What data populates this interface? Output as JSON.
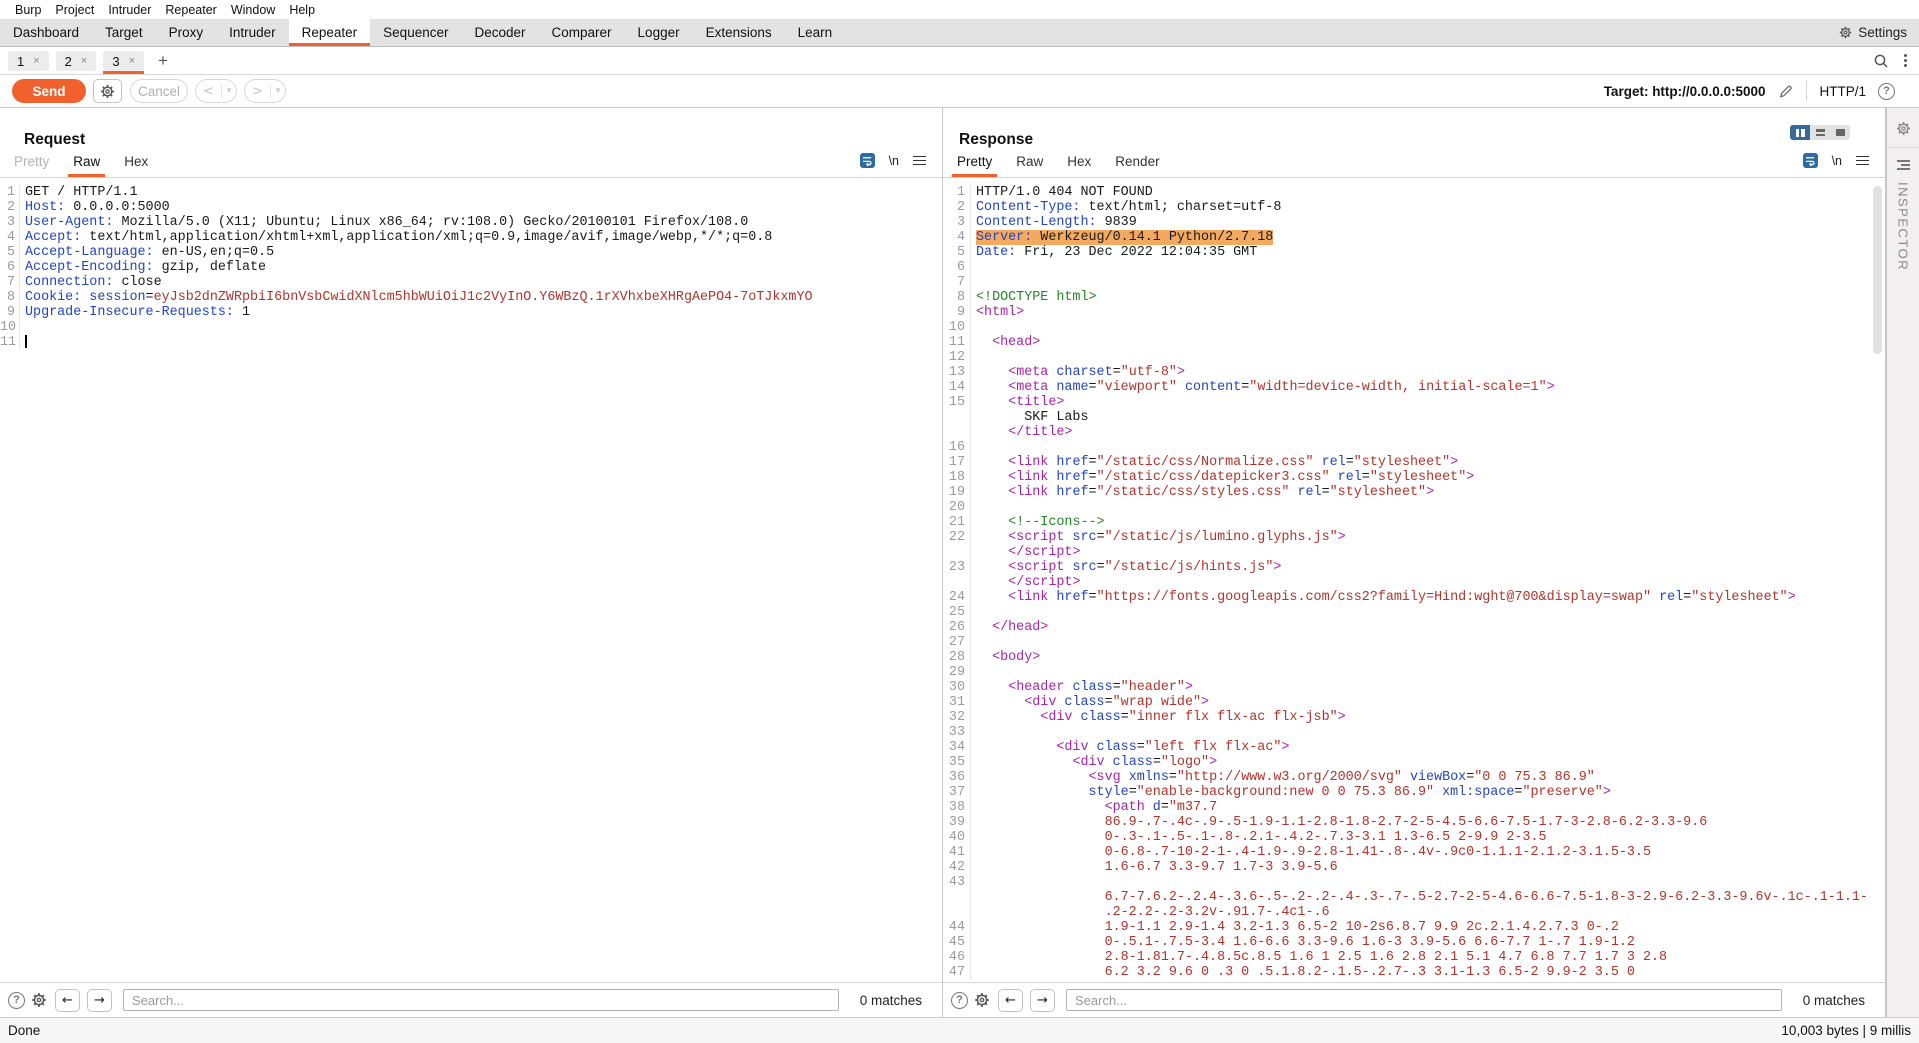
{
  "menu_bar": {
    "items": [
      "Burp",
      "Project",
      "Intruder",
      "Repeater",
      "Window",
      "Help"
    ]
  },
  "main_tab_bar": {
    "tabs": [
      "Dashboard",
      "Target",
      "Proxy",
      "Intruder",
      "Repeater",
      "Sequencer",
      "Decoder",
      "Comparer",
      "Logger",
      "Extensions",
      "Learn"
    ],
    "selected": "Repeater",
    "settings_label": "Settings"
  },
  "session_tabs": {
    "tabs": [
      "1",
      "2",
      "3"
    ],
    "selected": "3",
    "close_glyph": "×",
    "add_glyph": "+"
  },
  "toolbar": {
    "send": "Send",
    "cancel": "Cancel",
    "back": "<",
    "forward": ">",
    "dropdown_glyph": "▾",
    "target": "Target: http://0.0.0.0:5000",
    "protocol": "HTTP/1",
    "help_glyph": "?"
  },
  "request": {
    "title": "Request",
    "tabs": [
      {
        "label": "Pretty",
        "state": "disabled"
      },
      {
        "label": "Raw",
        "state": "selected"
      },
      {
        "label": "Hex",
        "state": "normal"
      }
    ],
    "newline_icon": "\\n",
    "search_placeholder": "Search...",
    "matches": "0 matches",
    "lines": [
      {
        "n": "1",
        "segs": [
          [
            "GET / HTTP/1.1",
            "p"
          ]
        ]
      },
      {
        "n": "2",
        "segs": [
          [
            "Host:",
            "h"
          ],
          [
            " 0.0.0.0:5000",
            "p"
          ]
        ]
      },
      {
        "n": "3",
        "segs": [
          [
            "User-Agent:",
            "h"
          ],
          [
            " Mozilla/5.0 (X11; Ubuntu; Linux x86_64; rv:108.0) Gecko/20100101 Firefox/108.0",
            "p"
          ]
        ]
      },
      {
        "n": "4",
        "segs": [
          [
            "Accept:",
            "h"
          ],
          [
            " text/html,application/xhtml+xml,application/xml;q=0.9,image/avif,image/webp,*/*;q=0.8",
            "p"
          ]
        ]
      },
      {
        "n": "5",
        "segs": [
          [
            "Accept-Language:",
            "h"
          ],
          [
            " en-US,en;q=0.5",
            "p"
          ]
        ]
      },
      {
        "n": "6",
        "segs": [
          [
            "Accept-Encoding:",
            "h"
          ],
          [
            " gzip, deflate",
            "p"
          ]
        ]
      },
      {
        "n": "7",
        "segs": [
          [
            "Connection:",
            "h"
          ],
          [
            " close",
            "p"
          ]
        ]
      },
      {
        "n": "8",
        "segs": [
          [
            "Cookie:",
            "h"
          ],
          [
            " ",
            "p"
          ],
          [
            "session",
            "h"
          ],
          [
            "=",
            "p"
          ],
          [
            "eyJsb2dnZWRpbiI6bnVsbCwidXNlcm5hbWUiOiJ1c2VyInO.Y6WBzQ.1rXVhxbeXHRgAePO4-7oTJkxmYO",
            "v"
          ]
        ]
      },
      {
        "n": "9",
        "segs": [
          [
            "Upgrade-Insecure-Requests:",
            "h"
          ],
          [
            " 1",
            "p"
          ]
        ]
      },
      {
        "n": "10",
        "segs": []
      },
      {
        "n": "11",
        "segs": [],
        "cursor": true
      }
    ]
  },
  "response": {
    "title": "Response",
    "tabs": [
      {
        "label": "Pretty",
        "state": "selected"
      },
      {
        "label": "Raw",
        "state": "normal"
      },
      {
        "label": "Hex",
        "state": "normal"
      },
      {
        "label": "Render",
        "state": "normal"
      }
    ],
    "newline_icon": "\\n",
    "search_placeholder": "Search...",
    "matches": "0 matches",
    "lines": [
      {
        "n": "1",
        "segs": [
          [
            "HTTP/1.0 404 NOT FOUND",
            "p"
          ]
        ]
      },
      {
        "n": "2",
        "segs": [
          [
            "Content-Type:",
            "h"
          ],
          [
            " text/html; charset=utf-8",
            "p"
          ]
        ]
      },
      {
        "n": "3",
        "segs": [
          [
            "Content-Length:",
            "h"
          ],
          [
            " 9839",
            "p"
          ]
        ]
      },
      {
        "n": "4",
        "hl": true,
        "segs": [
          [
            "Server:",
            "h"
          ],
          [
            " Werkzeug/0.14.1 Python/2.7.18",
            "p"
          ]
        ]
      },
      {
        "n": "5",
        "segs": [
          [
            "Date:",
            "h"
          ],
          [
            " Fri, 23 Dec 2022 12:04:35 GMT",
            "p"
          ]
        ]
      },
      {
        "n": "6",
        "segs": []
      },
      {
        "n": "7",
        "segs": []
      },
      {
        "n": "8",
        "segs": [
          [
            "<!DOCTYPE html>",
            "g"
          ]
        ]
      },
      {
        "n": "9",
        "segs": [
          [
            "<html>",
            "t"
          ]
        ]
      },
      {
        "n": "10",
        "segs": []
      },
      {
        "n": "11",
        "segs": [
          [
            "  ",
            "p"
          ],
          [
            "<head>",
            "t"
          ]
        ]
      },
      {
        "n": "12",
        "segs": []
      },
      {
        "n": "13",
        "segs": [
          [
            "    ",
            "p"
          ],
          [
            "<meta",
            "t"
          ],
          [
            " charset",
            "n"
          ],
          [
            "=",
            "p"
          ],
          [
            "\"utf-8\"",
            "v"
          ],
          [
            ">",
            "t"
          ]
        ]
      },
      {
        "n": "14",
        "segs": [
          [
            "    ",
            "p"
          ],
          [
            "<meta",
            "t"
          ],
          [
            " name",
            "n"
          ],
          [
            "=",
            "p"
          ],
          [
            "\"viewport\"",
            "v"
          ],
          [
            " content",
            "n"
          ],
          [
            "=",
            "p"
          ],
          [
            "\"width=device-width, initial-scale=1\"",
            "v"
          ],
          [
            ">",
            "t"
          ]
        ]
      },
      {
        "n": "15",
        "segs": [
          [
            "    ",
            "p"
          ],
          [
            "<title>",
            "t"
          ]
        ]
      },
      {
        "segs": [
          [
            "      SKF Labs",
            "p"
          ]
        ]
      },
      {
        "segs": [
          [
            "    ",
            "p"
          ],
          [
            "</title>",
            "t"
          ]
        ]
      },
      {
        "n": "16",
        "segs": []
      },
      {
        "n": "17",
        "segs": [
          [
            "    ",
            "p"
          ],
          [
            "<link",
            "t"
          ],
          [
            " href",
            "n"
          ],
          [
            "=",
            "p"
          ],
          [
            "\"/static/css/Normalize.css\"",
            "v"
          ],
          [
            " rel",
            "n"
          ],
          [
            "=",
            "p"
          ],
          [
            "\"stylesheet\"",
            "v"
          ],
          [
            ">",
            "t"
          ]
        ]
      },
      {
        "n": "18",
        "segs": [
          [
            "    ",
            "p"
          ],
          [
            "<link",
            "t"
          ],
          [
            " href",
            "n"
          ],
          [
            "=",
            "p"
          ],
          [
            "\"/static/css/datepicker3.css\"",
            "v"
          ],
          [
            " rel",
            "n"
          ],
          [
            "=",
            "p"
          ],
          [
            "\"stylesheet\"",
            "v"
          ],
          [
            ">",
            "t"
          ]
        ]
      },
      {
        "n": "19",
        "segs": [
          [
            "    ",
            "p"
          ],
          [
            "<link",
            "t"
          ],
          [
            " href",
            "n"
          ],
          [
            "=",
            "p"
          ],
          [
            "\"/static/css/styles.css\"",
            "v"
          ],
          [
            " rel",
            "n"
          ],
          [
            "=",
            "p"
          ],
          [
            "\"stylesheet\"",
            "v"
          ],
          [
            ">",
            "t"
          ]
        ]
      },
      {
        "n": "20",
        "segs": []
      },
      {
        "n": "21",
        "segs": [
          [
            "    ",
            "p"
          ],
          [
            "<!--Icons-->",
            "g"
          ]
        ]
      },
      {
        "n": "22",
        "segs": [
          [
            "    ",
            "p"
          ],
          [
            "<script",
            "t"
          ],
          [
            " src",
            "n"
          ],
          [
            "=",
            "p"
          ],
          [
            "\"/static/js/lumino.glyphs.js\"",
            "v"
          ],
          [
            ">",
            "t"
          ]
        ]
      },
      {
        "segs": [
          [
            "    ",
            "p"
          ],
          [
            "</script>",
            "t"
          ]
        ]
      },
      {
        "n": "23",
        "segs": [
          [
            "    ",
            "p"
          ],
          [
            "<script",
            "t"
          ],
          [
            " src",
            "n"
          ],
          [
            "=",
            "p"
          ],
          [
            "\"/static/js/hints.js\"",
            "v"
          ],
          [
            ">",
            "t"
          ]
        ]
      },
      {
        "segs": [
          [
            "    ",
            "p"
          ],
          [
            "</script>",
            "t"
          ]
        ]
      },
      {
        "n": "24",
        "segs": [
          [
            "    ",
            "p"
          ],
          [
            "<link",
            "t"
          ],
          [
            " href",
            "n"
          ],
          [
            "=",
            "p"
          ],
          [
            "\"https://fonts.googleapis.com/css2?family=Hind:wght@700&display=swap\"",
            "v"
          ],
          [
            " rel",
            "n"
          ],
          [
            "=",
            "p"
          ],
          [
            "\"stylesheet\"",
            "v"
          ],
          [
            ">",
            "t"
          ]
        ]
      },
      {
        "n": "25",
        "segs": []
      },
      {
        "n": "26",
        "segs": [
          [
            "  ",
            "p"
          ],
          [
            "</head>",
            "t"
          ]
        ]
      },
      {
        "n": "27",
        "segs": []
      },
      {
        "n": "28",
        "segs": [
          [
            "  ",
            "p"
          ],
          [
            "<body>",
            "t"
          ]
        ]
      },
      {
        "n": "29",
        "segs": []
      },
      {
        "n": "30",
        "segs": [
          [
            "    ",
            "p"
          ],
          [
            "<header",
            "t"
          ],
          [
            " class",
            "n"
          ],
          [
            "=",
            "p"
          ],
          [
            "\"header\"",
            "v"
          ],
          [
            ">",
            "t"
          ]
        ]
      },
      {
        "n": "31",
        "segs": [
          [
            "      ",
            "p"
          ],
          [
            "<div",
            "t"
          ],
          [
            " class",
            "n"
          ],
          [
            "=",
            "p"
          ],
          [
            "\"wrap wide\"",
            "v"
          ],
          [
            ">",
            "t"
          ]
        ]
      },
      {
        "n": "32",
        "segs": [
          [
            "        ",
            "p"
          ],
          [
            "<div",
            "t"
          ],
          [
            " class",
            "n"
          ],
          [
            "=",
            "p"
          ],
          [
            "\"inner flx flx-ac flx-jsb\"",
            "v"
          ],
          [
            ">",
            "t"
          ]
        ]
      },
      {
        "n": "33",
        "segs": []
      },
      {
        "n": "34",
        "segs": [
          [
            "          ",
            "p"
          ],
          [
            "<div",
            "t"
          ],
          [
            " class",
            "n"
          ],
          [
            "=",
            "p"
          ],
          [
            "\"left flx flx-ac\"",
            "v"
          ],
          [
            ">",
            "t"
          ]
        ]
      },
      {
        "n": "35",
        "segs": [
          [
            "            ",
            "p"
          ],
          [
            "<div",
            "t"
          ],
          [
            " class",
            "n"
          ],
          [
            "=",
            "p"
          ],
          [
            "\"logo\"",
            "v"
          ],
          [
            ">",
            "t"
          ]
        ]
      },
      {
        "n": "36",
        "segs": [
          [
            "              ",
            "p"
          ],
          [
            "<svg",
            "t"
          ],
          [
            " xmlns",
            "n"
          ],
          [
            "=",
            "p"
          ],
          [
            "\"http://www.w3.org/2000/svg\"",
            "v"
          ],
          [
            " viewBox",
            "n"
          ],
          [
            "=",
            "p"
          ],
          [
            "\"0 0 75.3 86.9\"",
            "v"
          ]
        ]
      },
      {
        "n": "37",
        "segs": [
          [
            "              ",
            "p"
          ],
          [
            "style",
            "n"
          ],
          [
            "=",
            "p"
          ],
          [
            "\"enable-background:new 0 0 75.3 86.9\"",
            "v"
          ],
          [
            " xml:space",
            "n"
          ],
          [
            "=",
            "p"
          ],
          [
            "\"preserve\"",
            "v"
          ],
          [
            ">",
            "t"
          ]
        ]
      },
      {
        "n": "38",
        "segs": [
          [
            "                ",
            "p"
          ],
          [
            "<path",
            "t"
          ],
          [
            " d",
            "n"
          ],
          [
            "=",
            "p"
          ],
          [
            "\"m37.7",
            "v"
          ]
        ]
      },
      {
        "n": "39",
        "segs": [
          [
            "                ",
            "p"
          ],
          [
            "86.9-.7-.4c-.9-.5-1.9-1.1-2.8-1.8-2.7-2-5-4.5-6.6-7.5-1.7-3-2.8-6.2-3.3-9.6",
            "v"
          ]
        ]
      },
      {
        "n": "40",
        "segs": [
          [
            "                ",
            "p"
          ],
          [
            "0-.3-.1-.5-.1-.8-.2.1-.4.2-.7.3-3.1 1.3-6.5 2-9.9 2-3.5",
            "v"
          ]
        ]
      },
      {
        "n": "41",
        "segs": [
          [
            "                ",
            "p"
          ],
          [
            "0-6.8-.7-10-2-1-.4-1.9-.9-2.8-1.41-.8-.4v-.9c0-1.1.1-2.1.2-3.1.5-3.5",
            "v"
          ]
        ]
      },
      {
        "n": "42",
        "segs": [
          [
            "                ",
            "p"
          ],
          [
            "1.6-6.7 3.3-9.7 1.7-3 3.9-5.6",
            "v"
          ]
        ]
      },
      {
        "n": "43",
        "segs": []
      },
      {
        "segs": [
          [
            "                ",
            "p"
          ],
          [
            "6.7-7.6.2-.2.4-.3.6-.5-.2-.2-.4-.3-.7-.5-2.7-2-5-4.6-6.6-7.5-1.8-3-2.9-6.2-3.3-9.6v-.1c-.1-1.1-",
            "v"
          ]
        ]
      },
      {
        "segs": [
          [
            "                ",
            "p"
          ],
          [
            ".2-2.2-.2-3.2v-.91.7-.4c1-.6",
            "v"
          ]
        ]
      },
      {
        "n": "44",
        "segs": [
          [
            "                ",
            "p"
          ],
          [
            "1.9-1.1 2.9-1.4 3.2-1.3 6.5-2 10-2s6.8.7 9.9 2c.2.1.4.2.7.3 0-.2",
            "v"
          ]
        ]
      },
      {
        "n": "45",
        "segs": [
          [
            "                ",
            "p"
          ],
          [
            "0-.5.1-.7.5-3.4 1.6-6.6 3.3-9.6 1.6-3 3.9-5.6 6.6-7.7 1-.7 1.9-1.2",
            "v"
          ]
        ]
      },
      {
        "n": "46",
        "segs": [
          [
            "                ",
            "p"
          ],
          [
            "2.8-1.81.7-.4.8.5c.8.5 1.6 1 2.5 1.6 2.8 2.1 5.1 4.7 6.8 7.7 1.7 3 2.8",
            "v"
          ]
        ]
      },
      {
        "n": "47",
        "segs": [
          [
            "                ",
            "p"
          ],
          [
            "6.2 3.2 9.6 0 .3 0 .5.1.8.2-.1.5-.2.7-.3 3.1-1.3 6.5-2 9.9-2 3.5 0",
            "v"
          ]
        ]
      }
    ]
  },
  "status_bar": {
    "left": "Done",
    "right": "10,003 bytes | 9 millis"
  },
  "inspector": {
    "label": "INSPECTOR"
  },
  "colors": {
    "accent_orange": "#f1612e",
    "syntax_name": "#2444c0",
    "syntax_value": "#b0342c",
    "syntax_tag": "#a625a6",
    "syntax_comment": "#278427",
    "highlight_bg": "#f4a961",
    "layout_selected": "#39699b",
    "wrap_icon_bg": "#2d6ca3"
  }
}
